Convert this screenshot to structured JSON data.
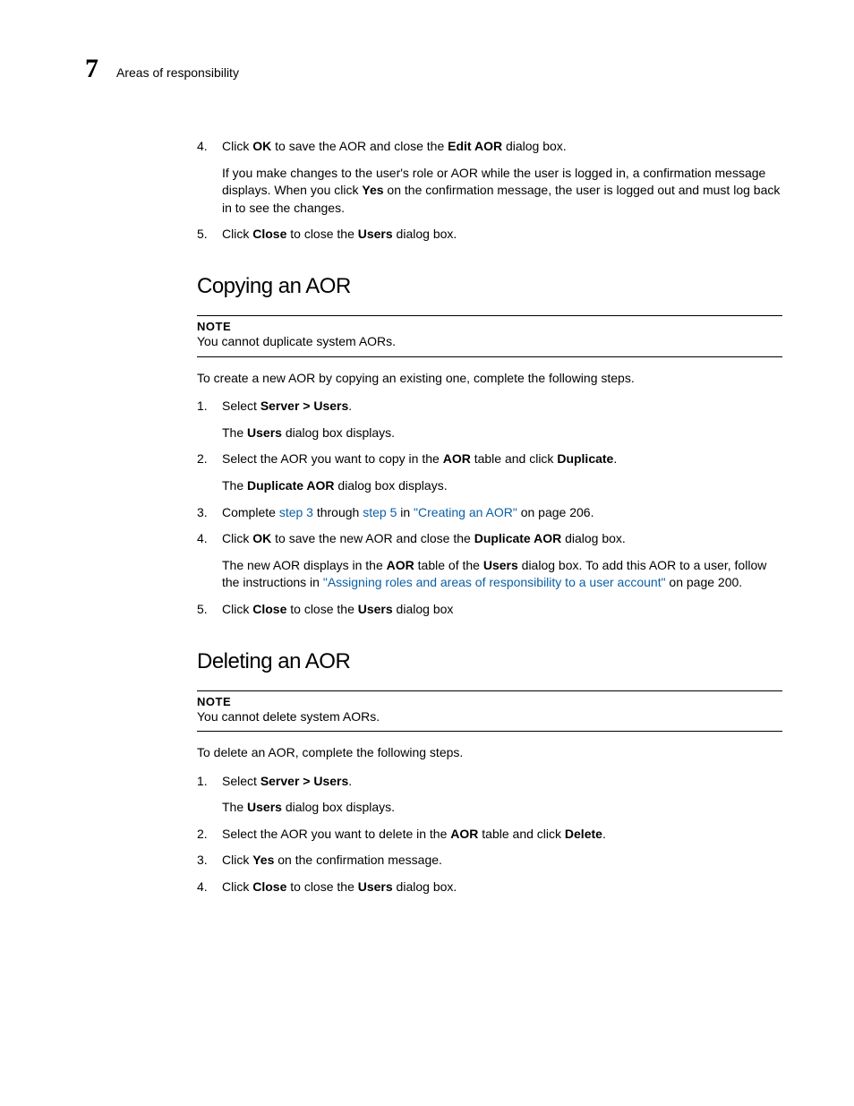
{
  "header": {
    "chapter_number": "7",
    "chapter_title": "Areas of responsibility"
  },
  "top_steps": {
    "s4": {
      "num": "4.",
      "pre": "Click ",
      "ok": "OK",
      "mid": " to save the AOR and close the ",
      "edit": "Edit AOR",
      "post": " dialog box.",
      "sub_pre": "If you make changes to the user's role or AOR while the user is logged in, a confirmation message displays. When you click ",
      "yes": "Yes",
      "sub_post": " on the confirmation message, the user is logged out and must log back in to see the changes."
    },
    "s5": {
      "num": "5.",
      "pre": "Click ",
      "close": "Close",
      "mid": " to close the ",
      "users": "Users",
      "post": " dialog box."
    }
  },
  "copying": {
    "heading": "Copying an AOR",
    "note_label": "NOTE",
    "note_text": "You cannot duplicate system AORs.",
    "intro": "To create a new AOR by copying an existing one, complete the following steps.",
    "s1": {
      "num": "1.",
      "pre": "Select ",
      "path": "Server > Users",
      "post": ".",
      "sub_pre": "The ",
      "users": "Users",
      "sub_post": " dialog box displays."
    },
    "s2": {
      "num": "2.",
      "pre": "Select the AOR you want to copy in the ",
      "aor": "AOR",
      "mid": " table and click ",
      "dup": "Duplicate",
      "post": ".",
      "sub_pre": "The ",
      "dupdlg": "Duplicate AOR",
      "sub_post": " dialog box displays."
    },
    "s3": {
      "num": "3.",
      "pre": "Complete ",
      "link1": "step 3",
      "mid1": " through ",
      "link2": "step 5",
      "mid2": " in ",
      "link3": "\"Creating an AOR\"",
      "post": " on page 206."
    },
    "s4": {
      "num": "4.",
      "pre": "Click ",
      "ok": "OK",
      "mid": " to save the new AOR and close the ",
      "dupdlg": "Duplicate AOR",
      "post": " dialog box.",
      "sub_pre": "The new AOR displays in the ",
      "aor": "AOR",
      "sub_mid1": " table of the ",
      "users": "Users",
      "sub_mid2": " dialog box. To add this AOR to a user, follow the instructions in ",
      "link": "\"Assigning roles and areas of responsibility to a user account\"",
      "sub_post": " on page 200."
    },
    "s5": {
      "num": "5.",
      "pre": "Click ",
      "close": "Close",
      "mid": " to close the ",
      "users": "Users",
      "post": " dialog box"
    }
  },
  "deleting": {
    "heading": "Deleting an AOR",
    "note_label": "NOTE",
    "note_text": "You cannot delete system AORs.",
    "intro": "To delete an AOR, complete the following steps.",
    "s1": {
      "num": "1.",
      "pre": "Select ",
      "path": "Server > Users",
      "post": ".",
      "sub_pre": "The ",
      "users": "Users",
      "sub_post": " dialog box displays."
    },
    "s2": {
      "num": "2.",
      "pre": "Select the AOR you want to delete in the ",
      "aor": "AOR",
      "mid": " table and click ",
      "del": "Delete",
      "post": "."
    },
    "s3": {
      "num": "3.",
      "pre": "Click ",
      "yes": "Yes",
      "post": " on the confirmation message."
    },
    "s4": {
      "num": "4.",
      "pre": "Click ",
      "close": "Close",
      "mid": " to close the ",
      "users": "Users",
      "post": " dialog box."
    }
  }
}
